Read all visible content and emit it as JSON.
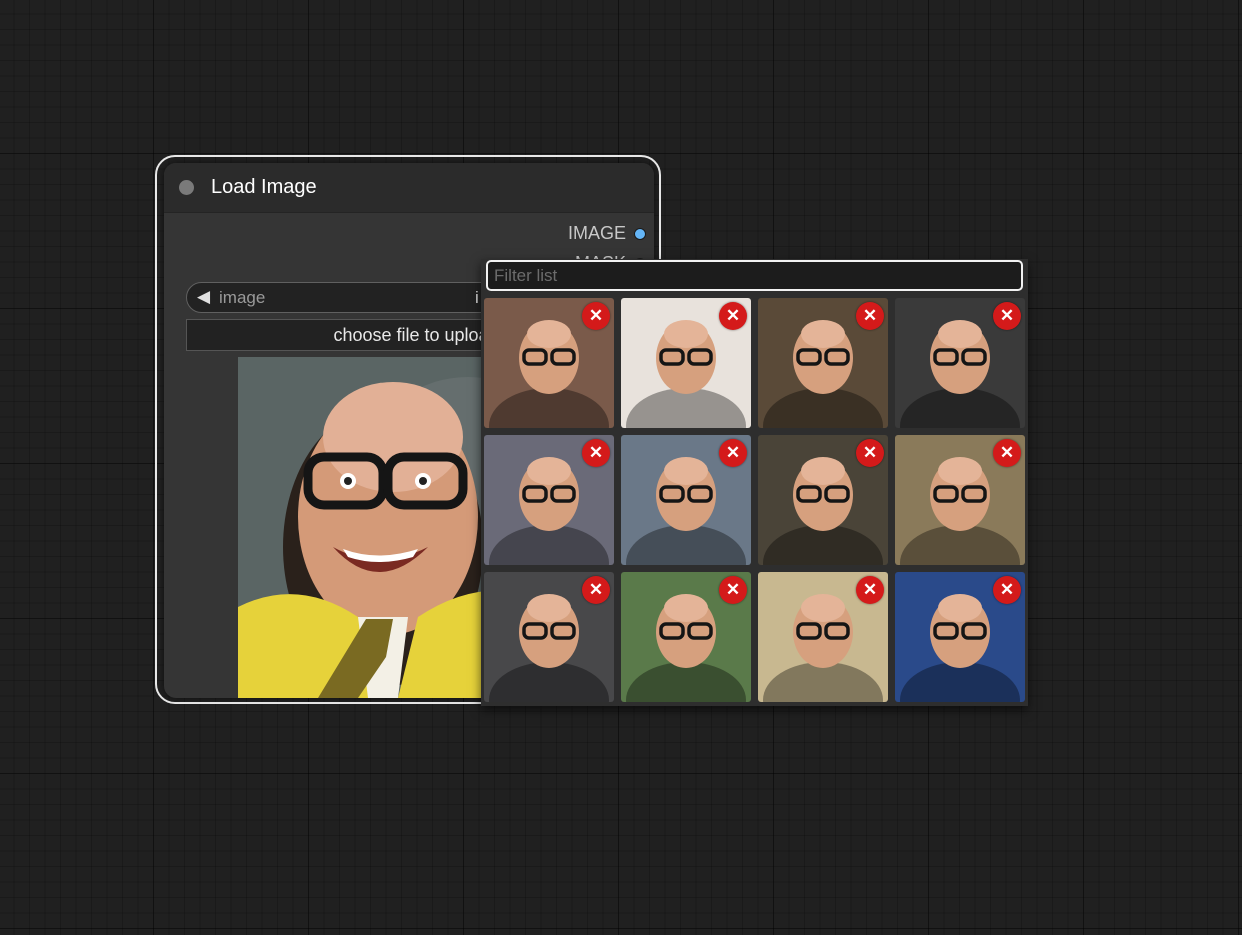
{
  "node": {
    "title": "Load Image",
    "outputs": [
      {
        "label": "IMAGE",
        "color": "#64b5f6"
      },
      {
        "label": "MASK",
        "color": "#81c784"
      }
    ],
    "combo": {
      "arrow": "◀",
      "label": "image",
      "value": "i"
    },
    "upload_label": "choose file to upload"
  },
  "dropdown": {
    "filter_placeholder": "Filter list",
    "remove_glyph": "✕",
    "items": [
      {
        "icon": "photo-thumbnail",
        "bg": "#7a5a4a"
      },
      {
        "icon": "photo-thumbnail",
        "bg": "#e8e2dc"
      },
      {
        "icon": "photo-thumbnail",
        "bg": "#5a4a38"
      },
      {
        "icon": "photo-thumbnail",
        "bg": "#3a3a3a"
      },
      {
        "icon": "photo-thumbnail",
        "bg": "#6a6a78"
      },
      {
        "icon": "photo-thumbnail",
        "bg": "#6a7888"
      },
      {
        "icon": "photo-thumbnail",
        "bg": "#4a4438"
      },
      {
        "icon": "photo-thumbnail",
        "bg": "#8a7a5a"
      },
      {
        "icon": "photo-thumbnail",
        "bg": "#48484a"
      },
      {
        "icon": "photo-thumbnail",
        "bg": "#5a7a4a"
      },
      {
        "icon": "photo-thumbnail",
        "bg": "#c8b890"
      },
      {
        "icon": "photo-thumbnail",
        "bg": "#2a4a8a"
      }
    ]
  }
}
